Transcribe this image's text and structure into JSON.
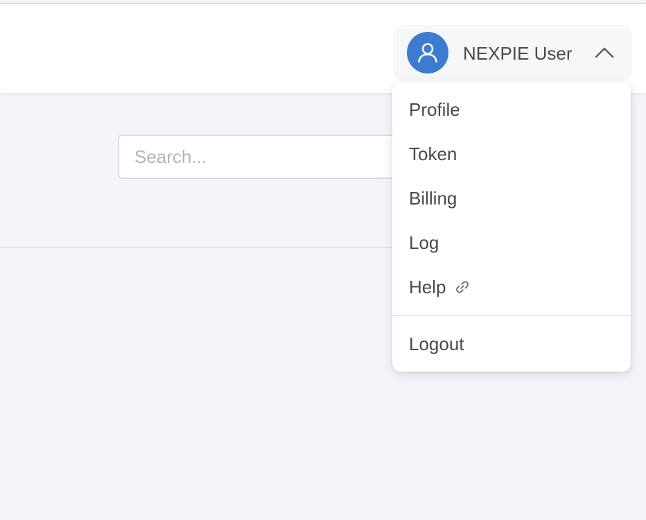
{
  "colors": {
    "accent": "#3d7bd1",
    "page_background": "#f4f5fa",
    "text": "#4a4a4a",
    "placeholder": "#b5b5b5"
  },
  "header": {
    "user_menu": {
      "avatar_icon": "user-icon",
      "name": "NEXPIE User",
      "toggle_icon": "chevron-up-icon"
    }
  },
  "search": {
    "placeholder": "Search...",
    "value": ""
  },
  "dropdown": {
    "items": [
      {
        "label": "Profile"
      },
      {
        "label": "Token"
      },
      {
        "label": "Billing"
      },
      {
        "label": "Log"
      },
      {
        "label": "Help",
        "icon": "external-link-icon"
      }
    ],
    "logout_label": "Logout"
  }
}
